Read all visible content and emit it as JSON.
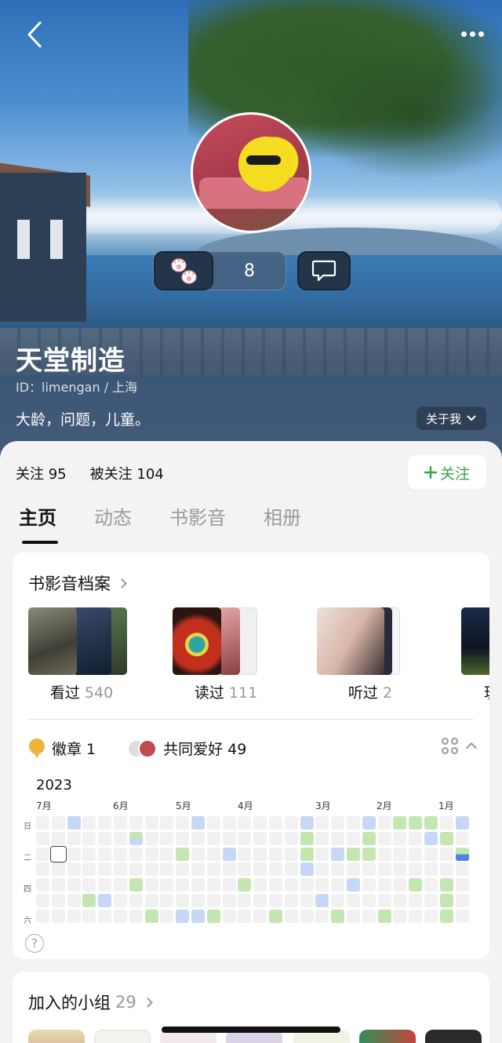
{
  "profile": {
    "name": "天堂制造",
    "id_line": "ID：limengan / 上海",
    "bio": "大龄，问题，儿童。",
    "about_label": "关于我",
    "paw_count": "8"
  },
  "stats": {
    "following": "关注 95",
    "followers": "被关注 104",
    "follow_button": "关注"
  },
  "tabs": [
    "主页",
    "动态",
    "书影音",
    "相册"
  ],
  "archive": {
    "title": "书影音档案",
    "items": [
      {
        "label": "看过",
        "count": "540"
      },
      {
        "label": "读过",
        "count": "111"
      },
      {
        "label": "听过",
        "count": "2"
      },
      {
        "label": "玩",
        "count": ""
      }
    ]
  },
  "badges": {
    "badge_label": "徽章 1",
    "hobby_label": "共同爱好 49"
  },
  "calendar": {
    "year": "2023",
    "months": [
      "7月",
      "6月",
      "5月",
      "4月",
      "3月",
      "2月",
      "1月"
    ],
    "weekdays": [
      "日",
      "二",
      "四",
      "六"
    ],
    "help": "?"
  },
  "groups": {
    "title": "加入的小组",
    "count": "29"
  },
  "colors": {
    "accent_green": "#2fa74a",
    "heat_green": "#c5e6b0",
    "heat_blue": "#c6d8f5"
  }
}
